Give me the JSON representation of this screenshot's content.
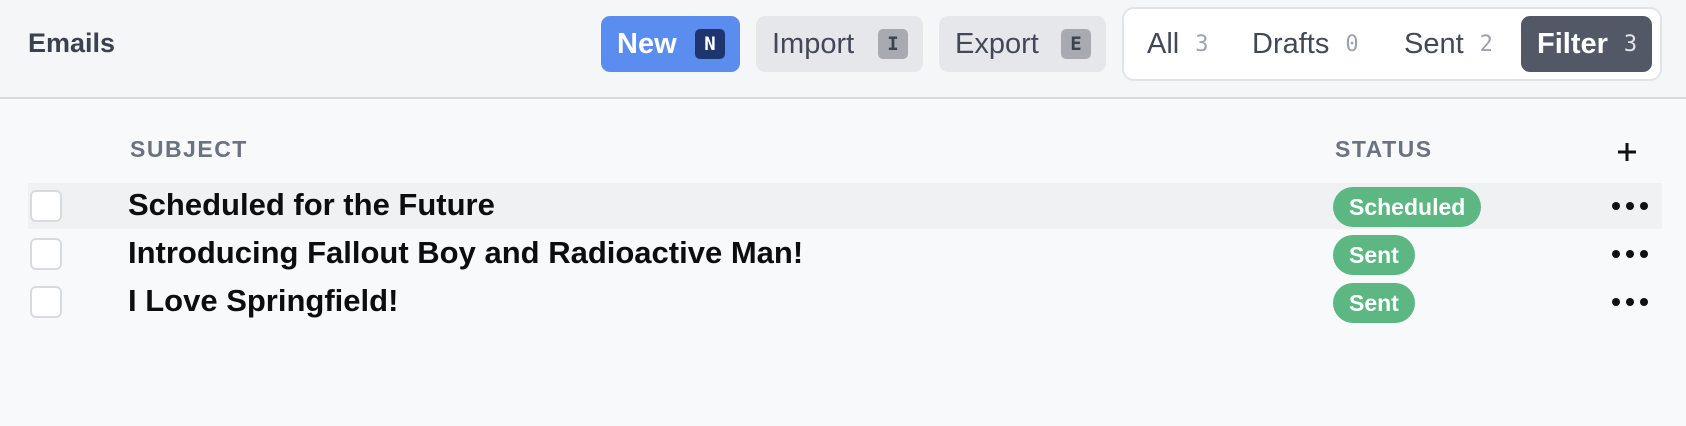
{
  "header": {
    "title": "Emails",
    "buttons": {
      "new": {
        "label": "New",
        "shortcut": "N"
      },
      "import": {
        "label": "Import",
        "shortcut": "I"
      },
      "export": {
        "label": "Export",
        "shortcut": "E"
      }
    },
    "filters": [
      {
        "label": "All",
        "count": "3"
      },
      {
        "label": "Drafts",
        "count": "0"
      },
      {
        "label": "Sent",
        "count": "2"
      },
      {
        "label": "Filter",
        "count": "3",
        "active": true
      }
    ]
  },
  "table": {
    "columns": {
      "subject": "SUBJECT",
      "status": "STATUS"
    },
    "add_column_icon": "plus-icon",
    "rows": [
      {
        "subject": "Scheduled for the Future",
        "status": "Scheduled",
        "highlighted": true
      },
      {
        "subject": "Introducing Fallout Boy and Radioactive Man!",
        "status": "Sent"
      },
      {
        "subject": "I Love Springfield!",
        "status": "Sent"
      }
    ]
  },
  "colors": {
    "primary": "#5b8def",
    "status_green": "#5cb783",
    "active_filter": "#525866"
  }
}
